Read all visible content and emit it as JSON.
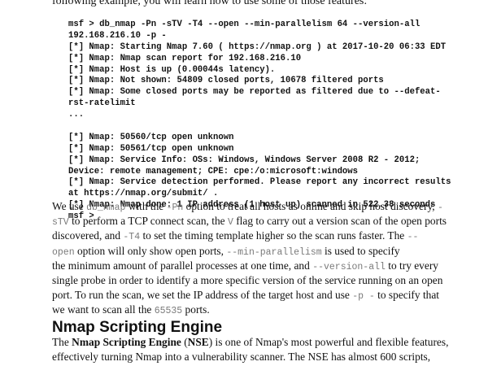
{
  "intro": "following example, you will learn how to use some of those features:",
  "code_lines": [
    "msf > db_nmap -Pn -sTV -T4 --open --min-parallelism 64 --version-all",
    "192.168.216.10 -p -",
    "[*] Nmap: Starting Nmap 7.60 ( https://nmap.org ) at 2017-10-20 06:33 EDT",
    "[*] Nmap: Nmap scan report for 192.168.216.10",
    "[*] Nmap: Host is up (0.00044s latency).",
    "[*] Nmap: Not shown: 54809 closed ports, 10678 filtered ports",
    "[*] Nmap: Some closed ports may be reported as filtered due to --defeat-",
    "rst-ratelimit",
    "...",
    "",
    "[*] Nmap: 50560/tcp open unknown",
    "[*] Nmap: 50561/tcp open unknown",
    "[*] Nmap: Service Info: OSs: Windows, Windows Server 2008 R2 - 2012;",
    "Device: remote management; CPE: cpe:/o:microsoft:windows",
    "[*] Nmap: Service detection performed. Please report any incorrect results",
    "at https://nmap.org/submit/ .",
    "[*] Nmap: Nmap done: 1 IP address (1 host up) scanned in 522.38 seconds",
    "msf >"
  ],
  "explanation": {
    "l1_a": "We use ",
    "l1_db_nmap": "db_nmap",
    "l1_b": " with the ",
    "l1_pn": "-Pn",
    "l1_c": " option to treat all hosts as online and skip host discovery, ",
    "l1_dash": "-",
    "l2_st": "sTV",
    "l2_a": " to perform a TCP connect scan, the ",
    "l2_v": "V",
    "l2_b": " flag to carry out a version scan of the open ports",
    "l3_a": "discovered, and ",
    "l3_t4": "-T4",
    "l3_b": " to set the timing template higher so the scan runs faster. The ",
    "l3_dash": "--",
    "l4_open": "open",
    "l4_a": " option will only show open ports, ",
    "l4_minpar": "--min-parallelism",
    "l4_b": " is used to specify",
    "l5": "the minimum amount of parallel processes at one time, and ",
    "l5_verall": "--version-all",
    "l5_b": " to try every",
    "l6": "single probe in order to identify a more specific version of the service running on an open",
    "l7_a": "port. To run the scan, we set the IP address of the target host and use ",
    "l7_p": "-p -",
    "l7_b": " to specify that",
    "l8_a": "we want to scan all the ",
    "l8_ports": "65535",
    "l8_b": " ports."
  },
  "heading": "Nmap Scripting Engine",
  "nse": {
    "l1_a": "The ",
    "l1_bold": "Nmap Scripting Engine",
    "l1_b": " (",
    "l1_nse": "NSE",
    "l1_c": ") is one of Nmap's most powerful and flexible features,",
    "l2": "effectively turning Nmap into a vulnerability scanner. The NSE has almost 600 scripts,"
  }
}
